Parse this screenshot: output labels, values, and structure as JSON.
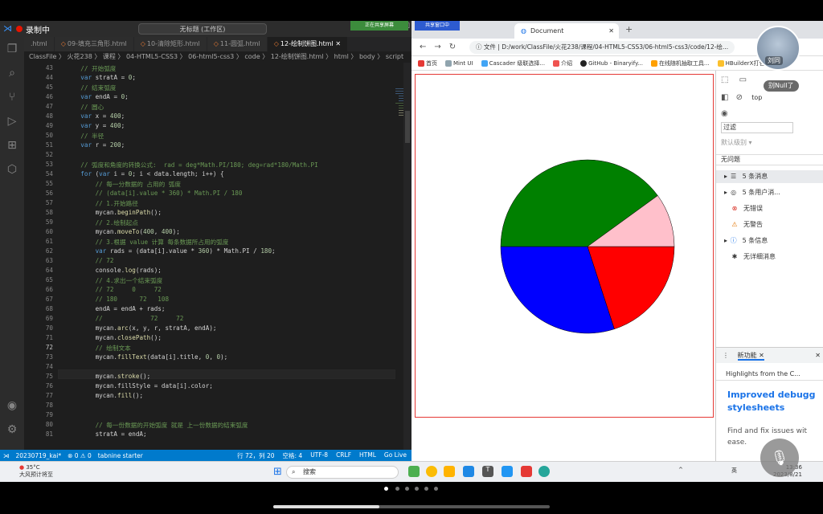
{
  "vscode": {
    "record_label": "录制中",
    "search_text": "无标题 (工作区)",
    "tabs": [
      ".html",
      "09-填充三角形.html",
      "10-清除矩形.html",
      "11-圆弧.html",
      "12-绘制饼图.html"
    ],
    "breadcrumb": "ClassFile 〉 火花238 〉 课程 〉 04-HTML5-CSS3 〉 06-html5-css3 〉 code 〉 12-绘制饼图.html 〉 html 〉 body 〉 script",
    "current_line": 72,
    "code_lines": [
      {
        "n": 43,
        "text": "    // 开始弧度"
      },
      {
        "n": 44,
        "text": "    var stratA = 0;"
      },
      {
        "n": 45,
        "text": "    // 结束弧度"
      },
      {
        "n": 46,
        "text": "    var endA = 0;"
      },
      {
        "n": 47,
        "text": "    // 圆心"
      },
      {
        "n": 48,
        "text": "    var x = 400;"
      },
      {
        "n": 49,
        "text": "    var y = 400;"
      },
      {
        "n": 50,
        "text": "    // 半径"
      },
      {
        "n": 51,
        "text": "    var r = 200;"
      },
      {
        "n": 52,
        "text": ""
      },
      {
        "n": 53,
        "text": "    // 弧度和角度的转换公式:  rad = deg*Math.PI/180; deg=rad*180/Math.PI"
      },
      {
        "n": 54,
        "text": "    for (var i = 0; i < data.length; i++) {"
      },
      {
        "n": 55,
        "text": "        // 每一分数据的 占用的 弧度"
      },
      {
        "n": 56,
        "text": "        // (data[i].value * 360) * Math.PI / 180"
      },
      {
        "n": 57,
        "text": "        // 1.开始路径"
      },
      {
        "n": 58,
        "text": "        mycan.beginPath();"
      },
      {
        "n": 59,
        "text": "        // 2.绘制起点"
      },
      {
        "n": 60,
        "text": "        mycan.moveTo(400, 400);"
      },
      {
        "n": 61,
        "text": "        // 3.根据 value 计算 每条数据所占用的弧度"
      },
      {
        "n": 62,
        "text": "        var rads = (data[i].value * 360) * Math.PI / 180;"
      },
      {
        "n": 63,
        "text": "        // 72"
      },
      {
        "n": 64,
        "text": "        console.log(rads);"
      },
      {
        "n": 65,
        "text": "        // 4.求出一个结束弧度"
      },
      {
        "n": 66,
        "text": "        // 72     0     72"
      },
      {
        "n": 67,
        "text": "        // 180      72   108"
      },
      {
        "n": 68,
        "text": "        endA = endA + rads;"
      },
      {
        "n": 69,
        "text": "        //             72     72"
      },
      {
        "n": 70,
        "text": "        mycan.arc(x, y, r, stratA, endA);"
      },
      {
        "n": 71,
        "text": "        mycan.closePath();"
      },
      {
        "n": 72,
        "text": "        // 绘制文本"
      },
      {
        "n": 73,
        "text": "        mycan.fillText(data[i].title, 0, 0);"
      },
      {
        "n": 74,
        "text": ""
      },
      {
        "n": 75,
        "text": "        mycan.stroke();"
      },
      {
        "n": 76,
        "text": "        mycan.fillStyle = data[i].color;"
      },
      {
        "n": 77,
        "text": "        mycan.fill();"
      },
      {
        "n": 78,
        "text": ""
      },
      {
        "n": 79,
        "text": ""
      },
      {
        "n": 80,
        "text": "        // 每一份数据的开始弧度 就是 上一份数据的结束弧度"
      },
      {
        "n": 81,
        "text": "        stratA = endA;"
      }
    ],
    "status": {
      "branch": "20230719_kai*",
      "problems": "⊗ 0 ⚠ 0",
      "tabnine": "tabnine starter",
      "position": "行 72，列 20",
      "spaces": "空格: 4",
      "encoding": "UTF-8",
      "eol": "CRLF",
      "language": "HTML",
      "golive": "Go Live"
    }
  },
  "browser": {
    "share_badge": "正在共享屏幕",
    "share_badge2": "共享窗口中",
    "tab_title": "Document",
    "url_prefix": "文件",
    "url": "D:/work/ClassFile/火花238/课程/04-HTML5-CSS3/06-html5-css3/code/12-绘...",
    "bookmarks": [
      "首页",
      "Mint UI",
      "Cascader 级联选择...",
      "介绍",
      "GitHub - Binaryify...",
      "在线随机抽取工具...",
      "HBuilderX打包成..."
    ],
    "pie_slices": [
      {
        "color": "#ff0000",
        "start_deg": 0,
        "end_deg": 72
      },
      {
        "color": "#0000ff",
        "start_deg": 72,
        "end_deg": 180
      },
      {
        "color": "#008000",
        "start_deg": 180,
        "end_deg": 324
      },
      {
        "color": "#ffc0cb",
        "start_deg": 324,
        "end_deg": 360
      }
    ]
  },
  "devtools": {
    "top_label": "top",
    "filter_placeholder": "过滤",
    "level_label": "默认级别 ▾",
    "no_issues": "无问题",
    "messages": [
      {
        "icon": "list-icon",
        "label": "5 条消息"
      },
      {
        "icon": "user-icon",
        "label": "5 条用户消..."
      },
      {
        "icon": "error-icon",
        "label": "无错误"
      },
      {
        "icon": "warning-icon",
        "label": "无警告"
      },
      {
        "icon": "info-icon",
        "label": "5 条信息"
      },
      {
        "icon": "bug-icon",
        "label": "无详细消息"
      }
    ],
    "new_features_tab": "新功能",
    "highlights": "Highlights from the C...",
    "improved_title": "Improved debugg stylesheets",
    "find_fix": "Find and fix issues wit ease."
  },
  "overlay": {
    "avatar_name": "刘同",
    "user_badge": "别Null了"
  },
  "taskbar": {
    "weather_temp": "35°C",
    "weather_desc": "大风预计将至",
    "search_label": "搜索",
    "ime": "英",
    "time": "13:36",
    "date": "2023/8/21"
  }
}
